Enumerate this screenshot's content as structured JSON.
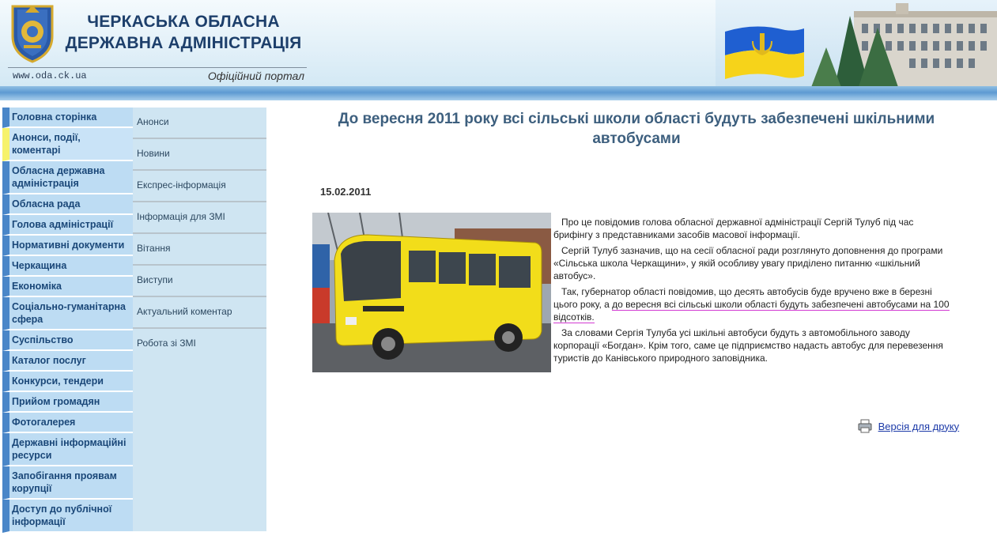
{
  "header": {
    "org_line1": "ЧЕРКАСЬКА ОБЛАСНА",
    "org_line2": "ДЕРЖАВНА АДМІНІСТРАЦІЯ",
    "site_url": "www.oda.ck.ua",
    "portal_label": "Офіційний портал"
  },
  "left_nav": {
    "items": [
      {
        "label": "Головна сторінка"
      },
      {
        "label": "Анонси, події, коментарі"
      },
      {
        "label": "Обласна державна адміністрація"
      },
      {
        "label": "Обласна рада"
      },
      {
        "label": "Голова адміністрації"
      },
      {
        "label": "Нормативні документи"
      },
      {
        "label": "Черкащина"
      },
      {
        "label": "Економіка"
      },
      {
        "label": "Соціально-гуманітарна сфера"
      },
      {
        "label": "Суспільство"
      },
      {
        "label": "Каталог послуг"
      },
      {
        "label": "Конкурси, тендери"
      },
      {
        "label": "Прийом громадян"
      },
      {
        "label": "Фотогалерея"
      },
      {
        "label": "Державні інформаційні ресурси"
      },
      {
        "label": "Запобігання проявам корупції"
      },
      {
        "label": "Доступ до публічної інформації"
      }
    ]
  },
  "sub_nav": {
    "items": [
      {
        "label": "Анонси"
      },
      {
        "label": "Новини"
      },
      {
        "label": "Експрес-інформація"
      },
      {
        "label": "Інформація для ЗМІ"
      },
      {
        "label": "Вітання"
      },
      {
        "label": "Виступи"
      },
      {
        "label": "Актуальний коментар"
      },
      {
        "label": "Робота зі ЗМІ"
      }
    ]
  },
  "article": {
    "title": "До вересня 2011 року всі сільські школи області будуть забезпечені шкільними автобусами",
    "date": "15.02.2011",
    "p1": "Про це повідомив голова обласної державної адміністрації Сергій Тулуб під час брифінгу з представниками засобів масової інформації.",
    "p2": "Сергій Тулуб зазначив, що на сесії обласної ради розглянуто доповнення до програми «Сільська школа Черкащини», у якій особливу увагу приділено питанню «шкільний автобус».",
    "p3_a": "Так, губернатор області повідомив, що десять автобусів буде вручено вже в березні цього року, а ",
    "p3_b": "до вересня всі сільські школи області будуть забезпечені автобусами на 100 відсотків.",
    "p4": "За словами Сергія Тулуба усі шкільні автобуси будуть з автомобільного заводу корпорації «Богдан». Крім того, саме це підприємство надасть автобус для перевезення туристів до Канівського природного заповідника."
  },
  "print": {
    "label": "Версія для друку",
    "icon": "printer-icon"
  },
  "colors": {
    "nav_bg": "#bddcf3",
    "nav_accent": "#4a86c8",
    "nav_active_accent": "#f6f26b",
    "title": "#3d5f7e",
    "highlight": "#d23ad2"
  }
}
